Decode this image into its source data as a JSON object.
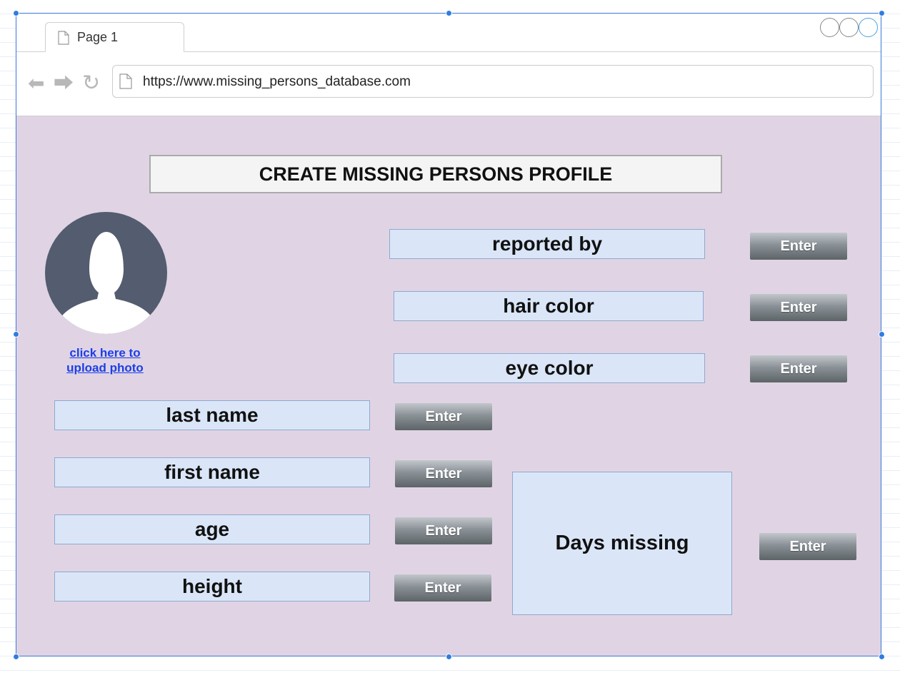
{
  "browser": {
    "tab_label": "Page 1",
    "url": "https://www.missing_persons_database.com"
  },
  "page": {
    "title": "CREATE MISSING PERSONS PROFILE",
    "upload_link": "click here to upload photo"
  },
  "fields": {
    "reported_by": "reported by",
    "hair_color": "hair color",
    "eye_color": "eye color",
    "last_name": "last name",
    "first_name": "first name",
    "age": "age",
    "height": "height",
    "days_missing": "Days missing"
  },
  "buttons": {
    "enter_label": "Enter"
  },
  "icons": {
    "back": "back-arrow-icon",
    "forward": "forward-arrow-icon",
    "reload": "reload-icon",
    "page": "page-icon",
    "avatar": "user-silhouette-icon"
  },
  "colors": {
    "content_background": "#e0d4e4",
    "field_background": "#dae6f8",
    "link": "#1b3ee8",
    "avatar": "#545c6f"
  }
}
